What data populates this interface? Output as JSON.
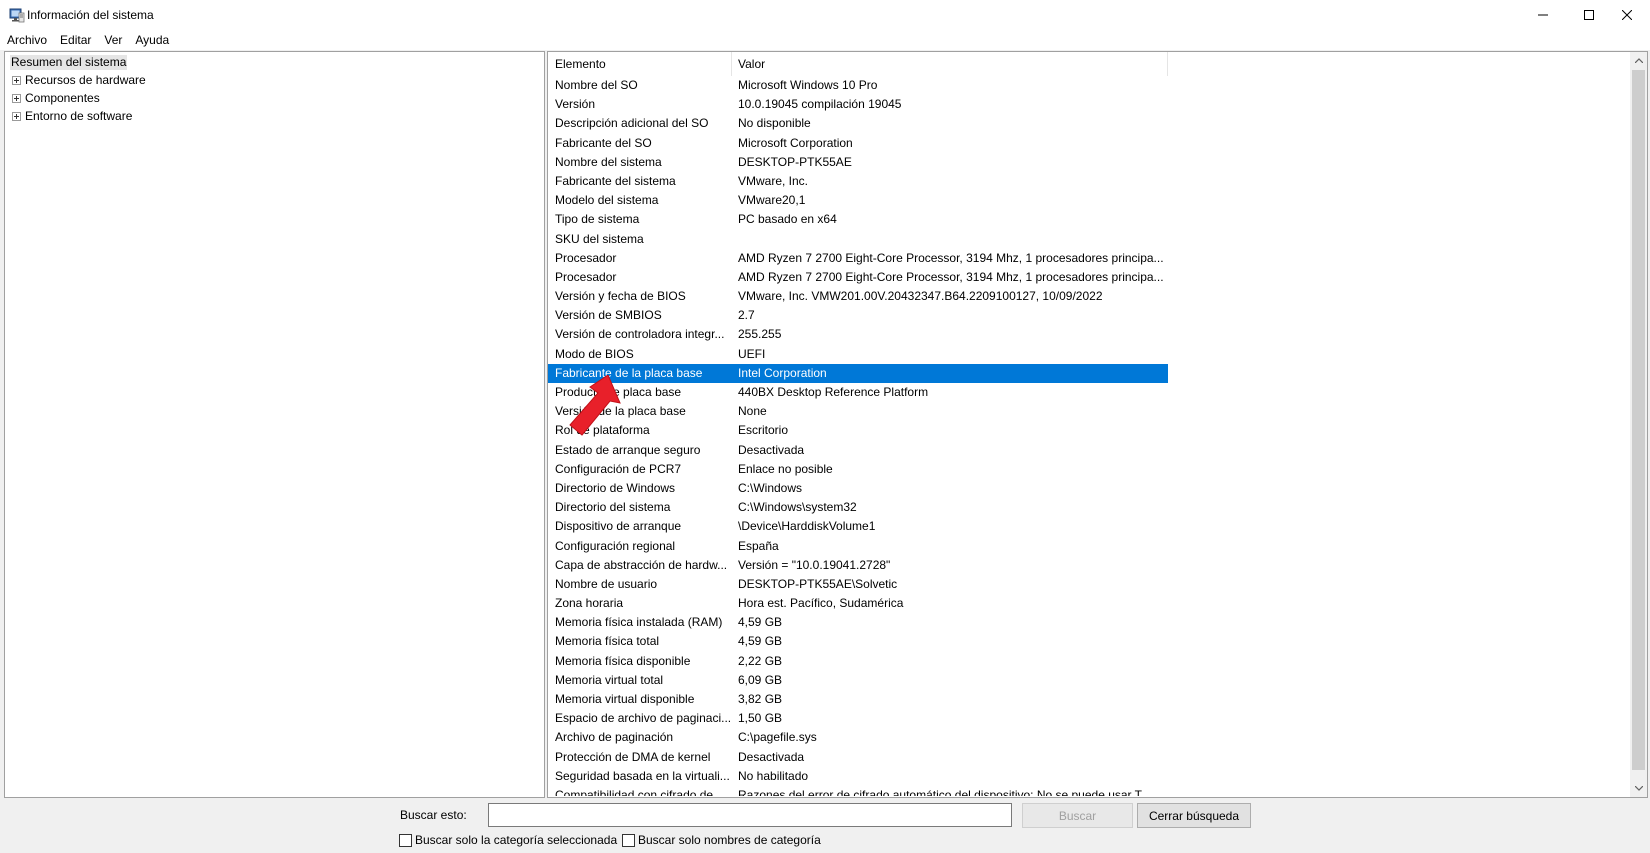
{
  "window": {
    "title": "Información del sistema"
  },
  "menu": {
    "items": [
      {
        "label": "Archivo"
      },
      {
        "label": "Editar"
      },
      {
        "label": "Ver"
      },
      {
        "label": "Ayuda"
      }
    ]
  },
  "tree": {
    "root": "Resumen del sistema",
    "children": [
      {
        "label": "Recursos de hardware"
      },
      {
        "label": "Componentes"
      },
      {
        "label": "Entorno de software"
      }
    ]
  },
  "table": {
    "columns": [
      "Elemento",
      "Valor"
    ],
    "selected_index": 15,
    "rows": [
      {
        "item": "Nombre del SO",
        "value": "Microsoft Windows 10 Pro"
      },
      {
        "item": "Versión",
        "value": "10.0.19045 compilación 19045"
      },
      {
        "item": "Descripción adicional del SO",
        "value": "No disponible"
      },
      {
        "item": "Fabricante del SO",
        "value": "Microsoft Corporation"
      },
      {
        "item": "Nombre del sistema",
        "value": "DESKTOP-PTK55AE"
      },
      {
        "item": "Fabricante del sistema",
        "value": "VMware, Inc."
      },
      {
        "item": "Modelo del sistema",
        "value": "VMware20,1"
      },
      {
        "item": "Tipo de sistema",
        "value": "PC basado en x64"
      },
      {
        "item": "SKU del sistema",
        "value": ""
      },
      {
        "item": "Procesador",
        "value": "AMD Ryzen 7 2700 Eight-Core Processor, 3194 Mhz, 1 procesadores principa..."
      },
      {
        "item": "Procesador",
        "value": "AMD Ryzen 7 2700 Eight-Core Processor, 3194 Mhz, 1 procesadores principa..."
      },
      {
        "item": "Versión y fecha de BIOS",
        "value": "VMware, Inc. VMW201.00V.20432347.B64.2209100127, 10/09/2022"
      },
      {
        "item": "Versión de SMBIOS",
        "value": "2.7"
      },
      {
        "item": "Versión de controladora integr...",
        "value": "255.255"
      },
      {
        "item": "Modo de BIOS",
        "value": "UEFI"
      },
      {
        "item": "Fabricante de la placa base",
        "value": "Intel Corporation"
      },
      {
        "item": "Producto de placa base",
        "value": "440BX Desktop Reference Platform"
      },
      {
        "item": "Versión de la placa base",
        "value": "None"
      },
      {
        "item": "Rol de plataforma",
        "value": "Escritorio"
      },
      {
        "item": "Estado de arranque seguro",
        "value": "Desactivada"
      },
      {
        "item": "Configuración de PCR7",
        "value": "Enlace no posible"
      },
      {
        "item": "Directorio de Windows",
        "value": "C:\\Windows"
      },
      {
        "item": "Directorio del sistema",
        "value": "C:\\Windows\\system32"
      },
      {
        "item": "Dispositivo de arranque",
        "value": "\\Device\\HarddiskVolume1"
      },
      {
        "item": "Configuración regional",
        "value": "España"
      },
      {
        "item": "Capa de abstracción de hardw...",
        "value": "Versión = \"10.0.19041.2728\""
      },
      {
        "item": "Nombre de usuario",
        "value": "DESKTOP-PTK55AE\\Solvetic"
      },
      {
        "item": "Zona horaria",
        "value": "Hora est. Pacífico, Sudamérica"
      },
      {
        "item": "Memoria física instalada (RAM)",
        "value": "4,59 GB"
      },
      {
        "item": "Memoria física total",
        "value": "4,59 GB"
      },
      {
        "item": "Memoria física disponible",
        "value": "2,22 GB"
      },
      {
        "item": "Memoria virtual total",
        "value": "6,09 GB"
      },
      {
        "item": "Memoria virtual disponible",
        "value": "3,82 GB"
      },
      {
        "item": "Espacio de archivo de paginaci...",
        "value": "1,50 GB"
      },
      {
        "item": "Archivo de paginación",
        "value": "C:\\pagefile.sys"
      },
      {
        "item": "Protección de DMA de kernel",
        "value": "Desactivada"
      },
      {
        "item": "Seguridad basada en la virtuali...",
        "value": "No habilitado"
      },
      {
        "item": "Compatibilidad con cifrado de...",
        "value": "Razones del error de cifrado automático del dispositivo: No se puede usar T..."
      }
    ]
  },
  "search": {
    "label": "Buscar esto:",
    "value": "",
    "search_button": "Buscar",
    "close_button": "Cerrar búsqueda",
    "only_selected_category": "Buscar solo la categoría seleccionada",
    "only_category_names": "Buscar solo nombres de categoría"
  },
  "colors": {
    "selection": "#0078d7",
    "annotation_arrow": "#e8202a"
  }
}
